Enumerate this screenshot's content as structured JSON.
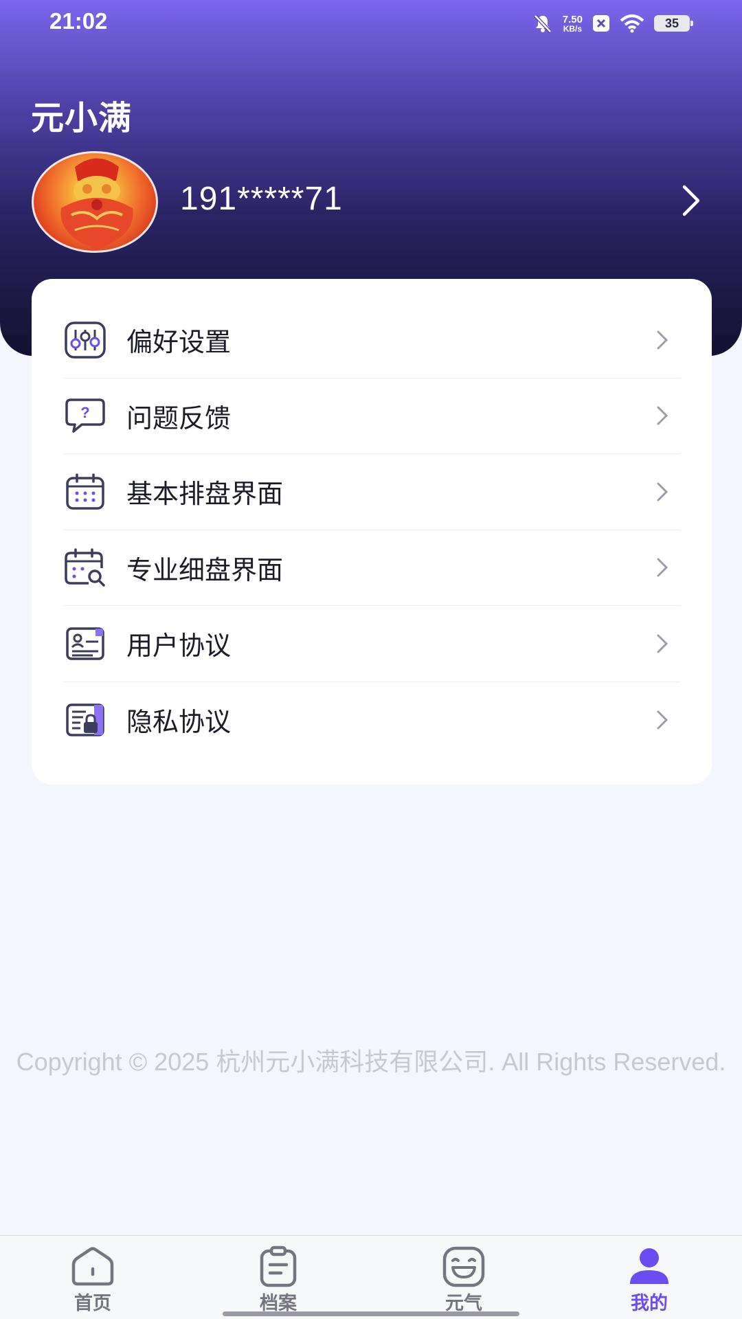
{
  "status_bar": {
    "time": "21:02",
    "net_speed_value": "7.50",
    "net_speed_unit": "KB/s",
    "battery": "35",
    "icons": [
      "mute-bell-icon",
      "x-app-icon",
      "wifi-icon",
      "battery-icon"
    ]
  },
  "header": {
    "app_title": "元小满",
    "phone": "191*****71"
  },
  "menu": {
    "items": [
      {
        "label": "偏好设置",
        "icon": "sliders-icon"
      },
      {
        "label": "问题反馈",
        "icon": "feedback-icon"
      },
      {
        "label": "基本排盘界面",
        "icon": "calendar-icon"
      },
      {
        "label": "专业细盘界面",
        "icon": "calendar-search-icon"
      },
      {
        "label": "用户协议",
        "icon": "user-agreement-icon"
      },
      {
        "label": "隐私协议",
        "icon": "privacy-lock-icon"
      }
    ]
  },
  "footer": {
    "copyright": "Copyright © 2025 杭州元小满科技有限公司. All Rights Reserved."
  },
  "tabs": [
    {
      "label": "首页",
      "icon": "home-icon",
      "active": false
    },
    {
      "label": "档案",
      "icon": "clipboard-icon",
      "active": false
    },
    {
      "label": "元气",
      "icon": "smile-face-icon",
      "active": false
    },
    {
      "label": "我的",
      "icon": "person-icon",
      "active": true
    }
  ],
  "colors": {
    "accent": "#6a4cf0",
    "header_top": "#7b66ec",
    "header_bottom": "#13122f",
    "page_background": "#f4f6fd"
  }
}
